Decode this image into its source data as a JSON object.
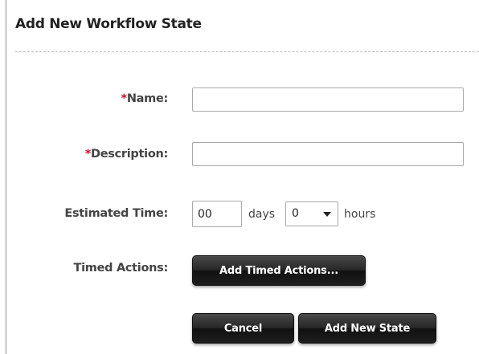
{
  "dialog": {
    "title": "Add New Workflow State"
  },
  "form": {
    "name": {
      "required_mark": "*",
      "label": "Name:",
      "value": ""
    },
    "description": {
      "required_mark": "*",
      "label": "Description:",
      "value": ""
    },
    "estimated_time": {
      "label": "Estimated Time:",
      "days_value": "00",
      "days_unit": "days",
      "hours_selected": "0",
      "hours_unit": "hours"
    },
    "timed_actions": {
      "label": "Timed Actions:",
      "button_label": "Add Timed Actions..."
    }
  },
  "actions": {
    "cancel_label": "Cancel",
    "submit_label": "Add New State"
  }
}
